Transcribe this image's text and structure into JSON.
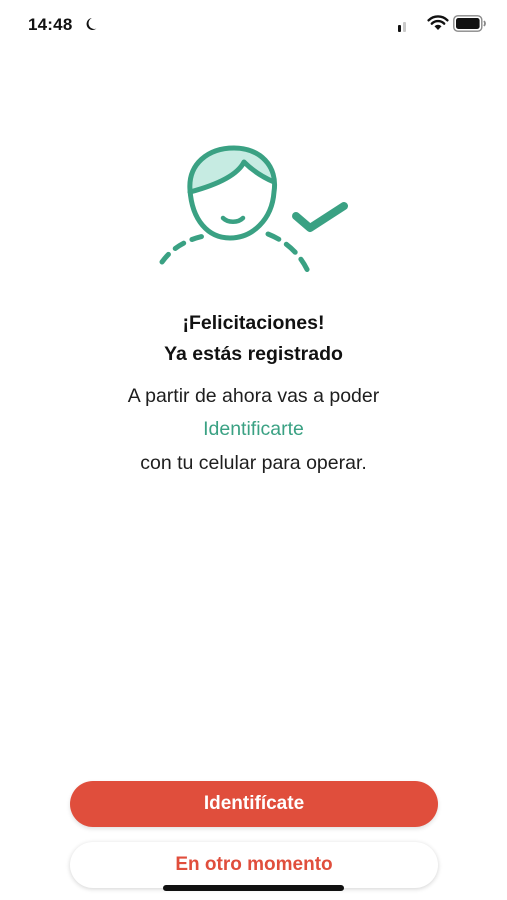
{
  "status_bar": {
    "time": "14:48",
    "icons": [
      "moon-icon",
      "cellular-signal-icon",
      "wifi-icon",
      "battery-icon"
    ]
  },
  "illustration": {
    "icon": "registered-user-check-icon",
    "stroke_color": "#3aa183",
    "fill_color": "#c6ebe2"
  },
  "message": {
    "title_line1": "¡Felicitaciones!",
    "title_line2": "Ya estás registrado",
    "body_line1": "A partir de ahora vas a poder",
    "body_link": "Identificarte",
    "body_line3": "con tu celular para operar."
  },
  "actions": {
    "primary_label": "Identifícate",
    "secondary_label": "En otro momento"
  },
  "colors": {
    "accent": "#e04e3c",
    "link": "#3aa183"
  }
}
